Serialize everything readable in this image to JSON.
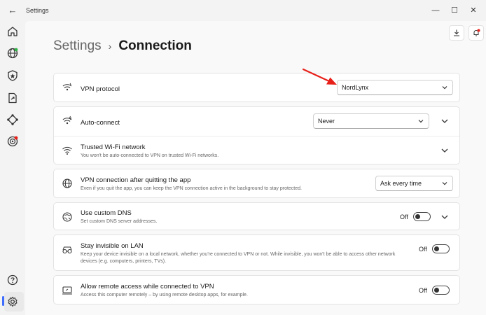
{
  "window": {
    "app_title": "Settings",
    "controls": {
      "minimize": "—",
      "maximize": "☐",
      "close": "✕"
    }
  },
  "sidebar": {
    "items": [
      {
        "name": "home",
        "icon": "home-icon"
      },
      {
        "name": "globe",
        "icon": "globe-icon"
      },
      {
        "name": "shield",
        "icon": "shield-icon"
      },
      {
        "name": "file-share",
        "icon": "file-share-icon"
      },
      {
        "name": "meshnet",
        "icon": "meshnet-icon"
      },
      {
        "name": "target",
        "icon": "target-icon"
      },
      {
        "name": "help",
        "icon": "help-icon"
      },
      {
        "name": "settings",
        "icon": "settings-icon",
        "active": true
      }
    ],
    "accent": "#3d6cff"
  },
  "breadcrumb": {
    "parent": "Settings",
    "separator": "›",
    "current": "Connection"
  },
  "settings": {
    "vpn_protocol": {
      "title": "VPN protocol",
      "value": "NordLynx"
    },
    "auto_connect": {
      "title": "Auto-connect",
      "value": "Never"
    },
    "trusted_wifi": {
      "title": "Trusted Wi-Fi network",
      "subtitle": "You won't be auto-connected to VPN on trusted Wi-Fi networks."
    },
    "vpn_after_quit": {
      "title": "VPN connection after quitting the app",
      "subtitle": "Even if you quit the app, you can keep the VPN connection active in the background to stay protected.",
      "value": "Ask every time"
    },
    "custom_dns": {
      "title": "Use custom DNS",
      "subtitle": "Set custom DNS server addresses.",
      "toggle_label": "Off"
    },
    "invisible_lan": {
      "title": "Stay invisible on LAN",
      "subtitle": "Keep your device invisible on a local network, whether you're connected to VPN or not. While invisible, you won't be able to access other network devices (e.g. computers, printers, TVs).",
      "toggle_label": "Off"
    },
    "remote_access": {
      "title": "Allow remote access while connected to VPN",
      "subtitle": "Access this computer remotely – by using remote desktop apps, for example.",
      "toggle_label": "Off"
    }
  },
  "colors": {
    "annotation_arrow": "#e8201a",
    "notification_dot": "#e8201a"
  }
}
